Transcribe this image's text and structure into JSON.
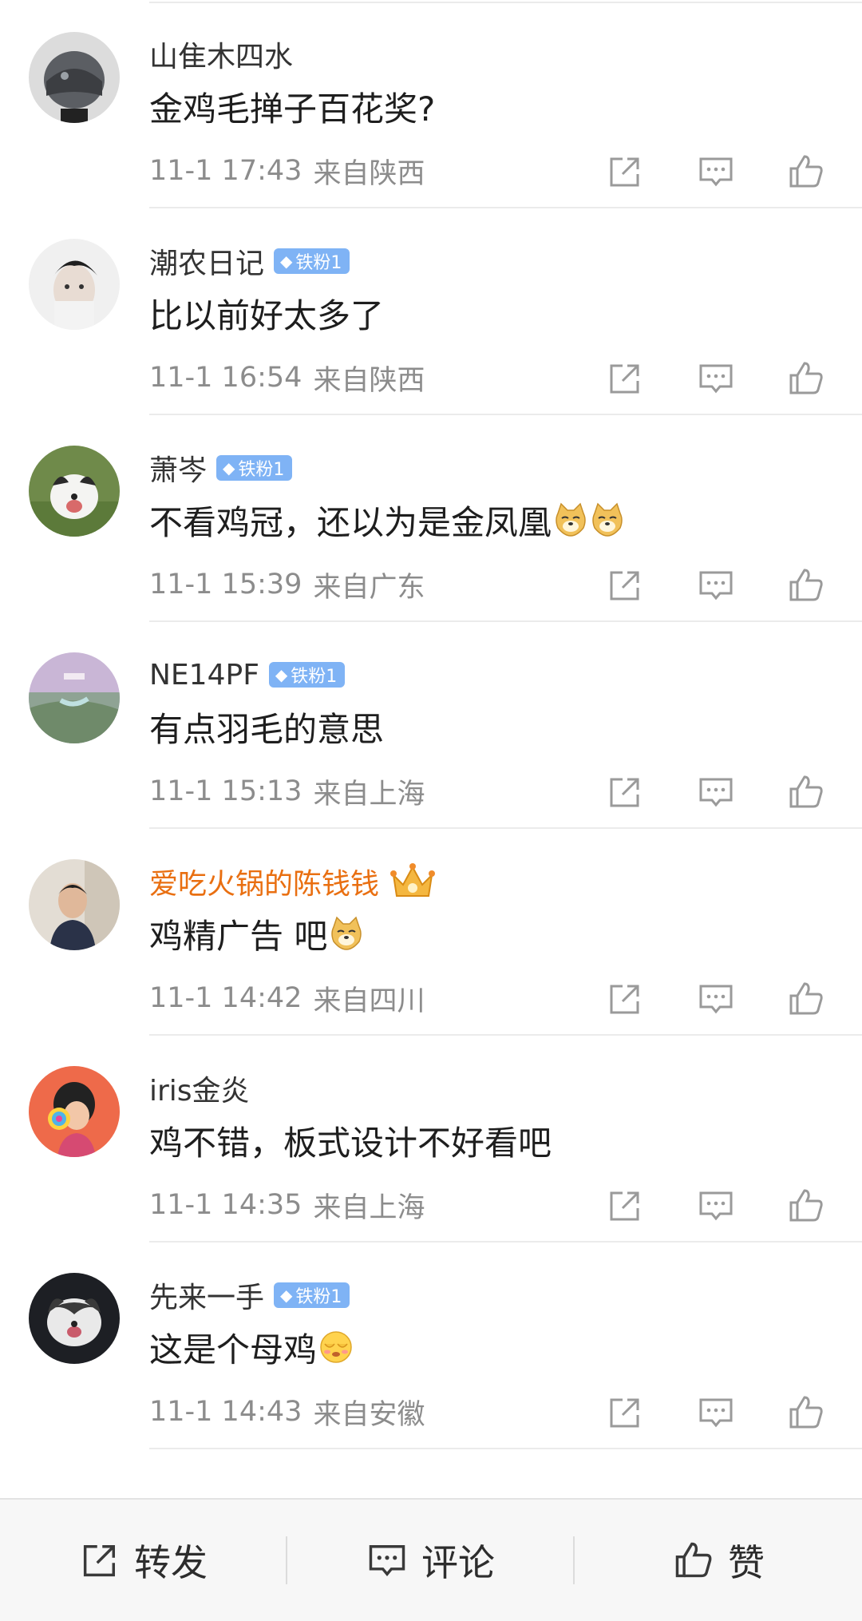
{
  "comments": [
    {
      "user": "山隹木四水",
      "badge": "",
      "vip": false,
      "text": "金鸡毛掸子百花奖?",
      "emojis": [],
      "time": "11-1 17:43",
      "location": "来自陕西"
    },
    {
      "user": "潮农日记",
      "badge": "铁粉1",
      "vip": false,
      "text": "比以前好太多了",
      "emojis": [],
      "time": "11-1 16:54",
      "location": "来自陕西"
    },
    {
      "user": "萧岑",
      "badge": "铁粉1",
      "vip": false,
      "text": "不看鸡冠，还以为是金凤凰",
      "emojis": [
        "doge-emoji",
        "doge-emoji"
      ],
      "time": "11-1 15:39",
      "location": "来自广东"
    },
    {
      "user": "NE14PF",
      "badge": "铁粉1",
      "vip": false,
      "text": "有点羽毛的意思",
      "emojis": [],
      "time": "11-1 15:13",
      "location": "来自上海"
    },
    {
      "user": "爱吃火锅的陈钱钱",
      "badge": "",
      "vip": true,
      "text": "鸡精广告 吧",
      "emojis": [
        "doge-emoji"
      ],
      "time": "11-1 14:42",
      "location": "来自四川"
    },
    {
      "user": "iris金炎",
      "badge": "",
      "vip": false,
      "text": "鸡不错，板式设计不好看吧",
      "emojis": [],
      "time": "11-1 14:35",
      "location": "来自上海"
    },
    {
      "user": "先来一手",
      "badge": "铁粉1",
      "vip": false,
      "text": "这是个母鸡",
      "emojis": [
        "shy-emoji"
      ],
      "time": "11-1 14:43",
      "location": "来自安徽"
    }
  ],
  "bottom_bar": {
    "forward_label": "转发",
    "comment_label": "评论",
    "like_label": "赞"
  },
  "colors": {
    "vip_name": "#e96f11",
    "badge_bg": "#7fb3f5",
    "meta_text": "#8c8c8c"
  }
}
